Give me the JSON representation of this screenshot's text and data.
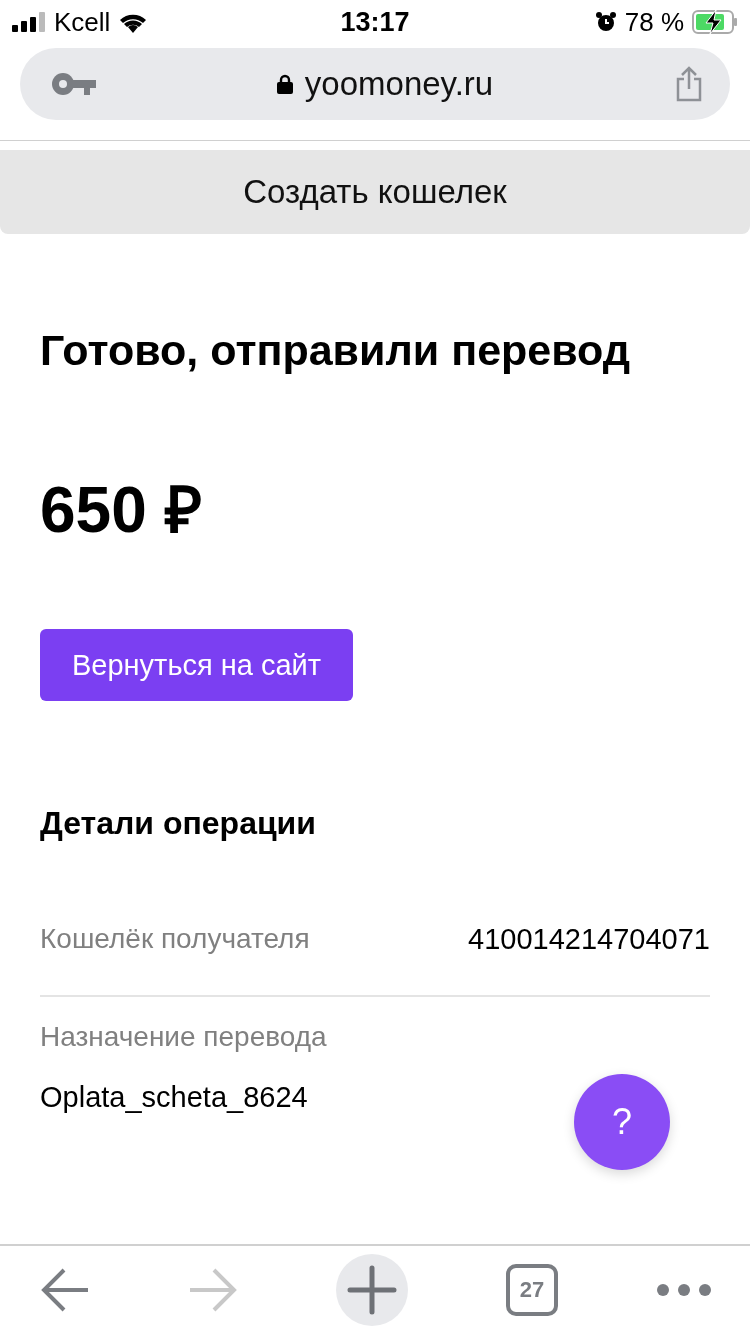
{
  "status_bar": {
    "carrier": "Kcell",
    "time": "13:17",
    "battery": "78 %"
  },
  "browser": {
    "url": "yoomoney.ru"
  },
  "banner": {
    "label": "Создать кошелек"
  },
  "title": "Готово, отправили перевод",
  "amount": "650 ₽",
  "return_button": "Вернуться на сайт",
  "details": {
    "heading": "Детали операции",
    "rows": [
      {
        "label": "Кошелёк получателя",
        "value": "410014214704071",
        "kind": "inline"
      },
      {
        "label": "Назначение перевода",
        "value": "Oplata_scheta_8624",
        "kind": "stacked"
      }
    ]
  },
  "help_button": "?",
  "toolbar": {
    "forward_disabled": true,
    "tabs_count": "27"
  }
}
